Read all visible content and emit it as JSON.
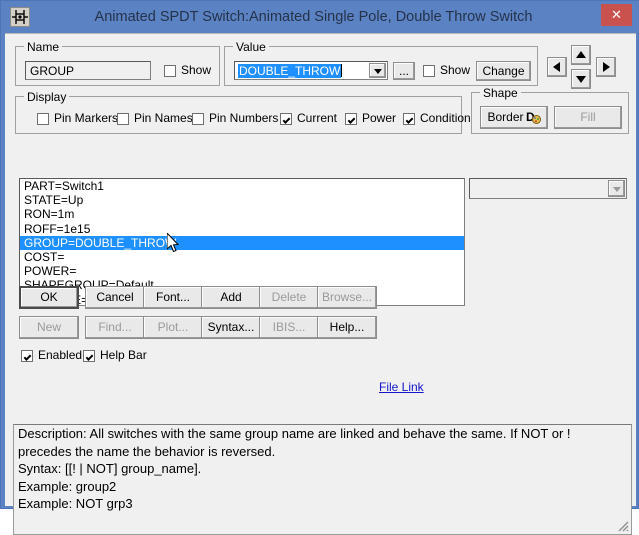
{
  "window": {
    "title": "Animated SPDT Switch:Animated Single Pole, Double Throw Switch",
    "close_label": "✕",
    "icon_name": "switch-schematic-icon",
    "titlebar_color": "#5b83c4",
    "close_color": "#c9524f"
  },
  "name_group": {
    "title": "Name",
    "value": "GROUP",
    "show_label": "Show",
    "show_checked": false
  },
  "value_group": {
    "title": "Value",
    "value": "DOUBLE_THROW",
    "selected": true,
    "browse_label": "...",
    "show_label": "Show",
    "show_checked": false,
    "change_label": "Change"
  },
  "nav": {
    "left_label": "◀",
    "up_label": "▲",
    "down_label": "▼",
    "right_label": "▶"
  },
  "display_group": {
    "title": "Display",
    "items": [
      {
        "label": "Pin Markers",
        "checked": false
      },
      {
        "label": "Pin Names",
        "checked": false
      },
      {
        "label": "Pin Numbers",
        "checked": false
      },
      {
        "label": "Current",
        "checked": true
      },
      {
        "label": "Power",
        "checked": true
      },
      {
        "label": "Condition",
        "checked": true
      }
    ]
  },
  "shape_group": {
    "title": "Shape",
    "border_label": "Border",
    "border_icon": "color-palette-icon",
    "fill_label": "Fill",
    "fill_enabled": false
  },
  "shape_combo": {
    "value": "",
    "enabled": false
  },
  "properties": [
    {
      "text": "PART=Switch1",
      "selected": false
    },
    {
      "text": "STATE=Up",
      "selected": false
    },
    {
      "text": "RON=1m",
      "selected": false
    },
    {
      "text": "ROFF=1e15",
      "selected": false
    },
    {
      "text": "GROUP=DOUBLE_THROW",
      "selected": true
    },
    {
      "text": "COST=",
      "selected": false
    },
    {
      "text": "POWER=",
      "selected": false
    },
    {
      "text": "SHAPEGROUP=Default",
      "selected": false
    },
    {
      "text": "PACKAGE=",
      "selected": false
    }
  ],
  "buttons_row1": [
    {
      "label": "OK",
      "enabled": true,
      "default": true
    },
    {
      "label": "Cancel",
      "enabled": true,
      "default": false
    },
    {
      "label": "Font...",
      "enabled": true,
      "default": false
    },
    {
      "label": "Add",
      "enabled": true,
      "default": false
    },
    {
      "label": "Delete",
      "enabled": false,
      "default": false
    },
    {
      "label": "Browse...",
      "enabled": false,
      "default": false
    }
  ],
  "buttons_row2": [
    {
      "label": "New",
      "enabled": false,
      "default": false
    },
    {
      "label": "Find...",
      "enabled": false,
      "default": false
    },
    {
      "label": "Plot...",
      "enabled": false,
      "default": false
    },
    {
      "label": "Syntax...",
      "enabled": true,
      "default": false
    },
    {
      "label": "IBIS...",
      "enabled": false,
      "default": false
    },
    {
      "label": "Help...",
      "enabled": true,
      "default": false
    }
  ],
  "footer": {
    "enabled_label": "Enabled",
    "enabled_checked": true,
    "helpbar_label": "Help Bar",
    "helpbar_checked": true,
    "file_link_label": "File Link",
    "file_link_color": "#1414cc"
  },
  "description": {
    "line1": "Description: All switches with the same group name are linked and behave the same. If NOT or ! precedes the name the behavior is reversed.",
    "line2": "Syntax: [[! | NOT] group_name].",
    "line3": "Example: group2",
    "line4": "Example: NOT grp3"
  }
}
